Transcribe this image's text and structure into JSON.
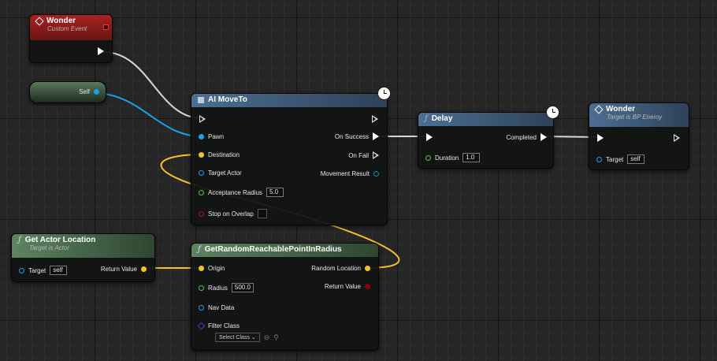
{
  "nodes": {
    "wonder_event": {
      "title": "Wonder",
      "subtitle": "Custom Event"
    },
    "self_node": {
      "label": "Self"
    },
    "ai_moveto": {
      "title": "AI MoveTo",
      "pins": {
        "pawn": "Pawn",
        "destination": "Destination",
        "target_actor": "Target Actor",
        "acceptance_radius": "Acceptance Radius",
        "acceptance_radius_value": "5.0",
        "stop_on_overlap": "Stop on Overlap",
        "on_success": "On Success",
        "on_fail": "On Fail",
        "movement_result": "Movement Result"
      }
    },
    "delay": {
      "title": "Delay",
      "duration_label": "Duration",
      "duration_value": "1.0",
      "completed": "Completed"
    },
    "wonder_call": {
      "title": "Wonder",
      "subtitle": "Target is BP Enemy",
      "target_label": "Target",
      "target_value": "self"
    },
    "get_actor_location": {
      "title": "Get Actor Location",
      "subtitle": "Target is Actor",
      "target_label": "Target",
      "target_value": "self",
      "return_value": "Return Value"
    },
    "get_random_point": {
      "title": "GetRandomReachablePointInRadius",
      "origin": "Origin",
      "radius": "Radius",
      "radius_value": "500.0",
      "nav_data": "Nav Data",
      "filter_class": "Filter Class",
      "select_class": "Select Class",
      "random_location": "Random Location",
      "return_value": "Return Value"
    }
  },
  "colors": {
    "event_header": "#8a1a1a",
    "function_header": "#3c5a78",
    "pure_header": "#4f6e52",
    "object_pin": "#1aa0e8",
    "vector_pin": "#f5c22a",
    "float_pin": "#58c24a",
    "bool_pin": "#8b0000",
    "struct_pin": "#1aa0e8",
    "class_pin": "#6a25c9"
  }
}
